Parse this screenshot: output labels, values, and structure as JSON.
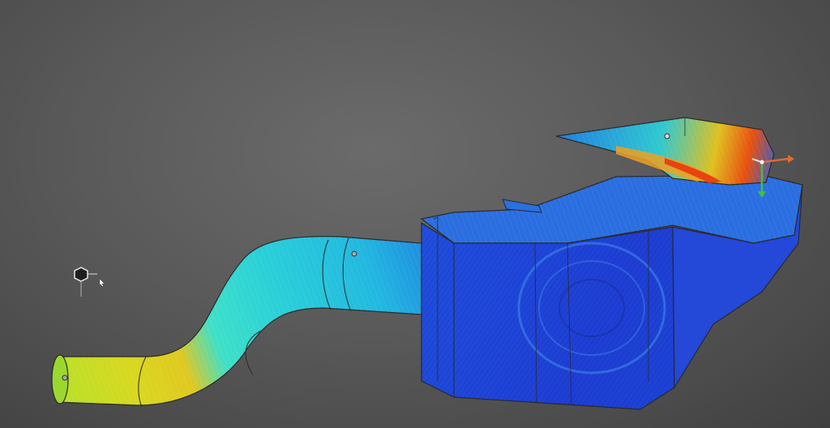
{
  "viewport": {
    "background_top": "#6b6b6b",
    "background_bottom": "#404040"
  },
  "colors": {
    "flow_low": "#1f3fd6",
    "flow_mid_low": "#22a6e0",
    "flow_mid": "#3ee0c8",
    "flow_mid_high": "#b8e028",
    "flow_high": "#f0d020",
    "flow_max": "#e83a10",
    "outline": "#2a2a2a",
    "gizmo_x": "#e06a30",
    "gizmo_y": "#40c040",
    "gizmo_z": "#e0e0e0"
  },
  "icons": {
    "orientation_gizmo": "hexagon-axis-icon",
    "cursor": "cursor-icon",
    "probe_points": "probe-point-icon",
    "triad": "axis-triad-icon"
  }
}
